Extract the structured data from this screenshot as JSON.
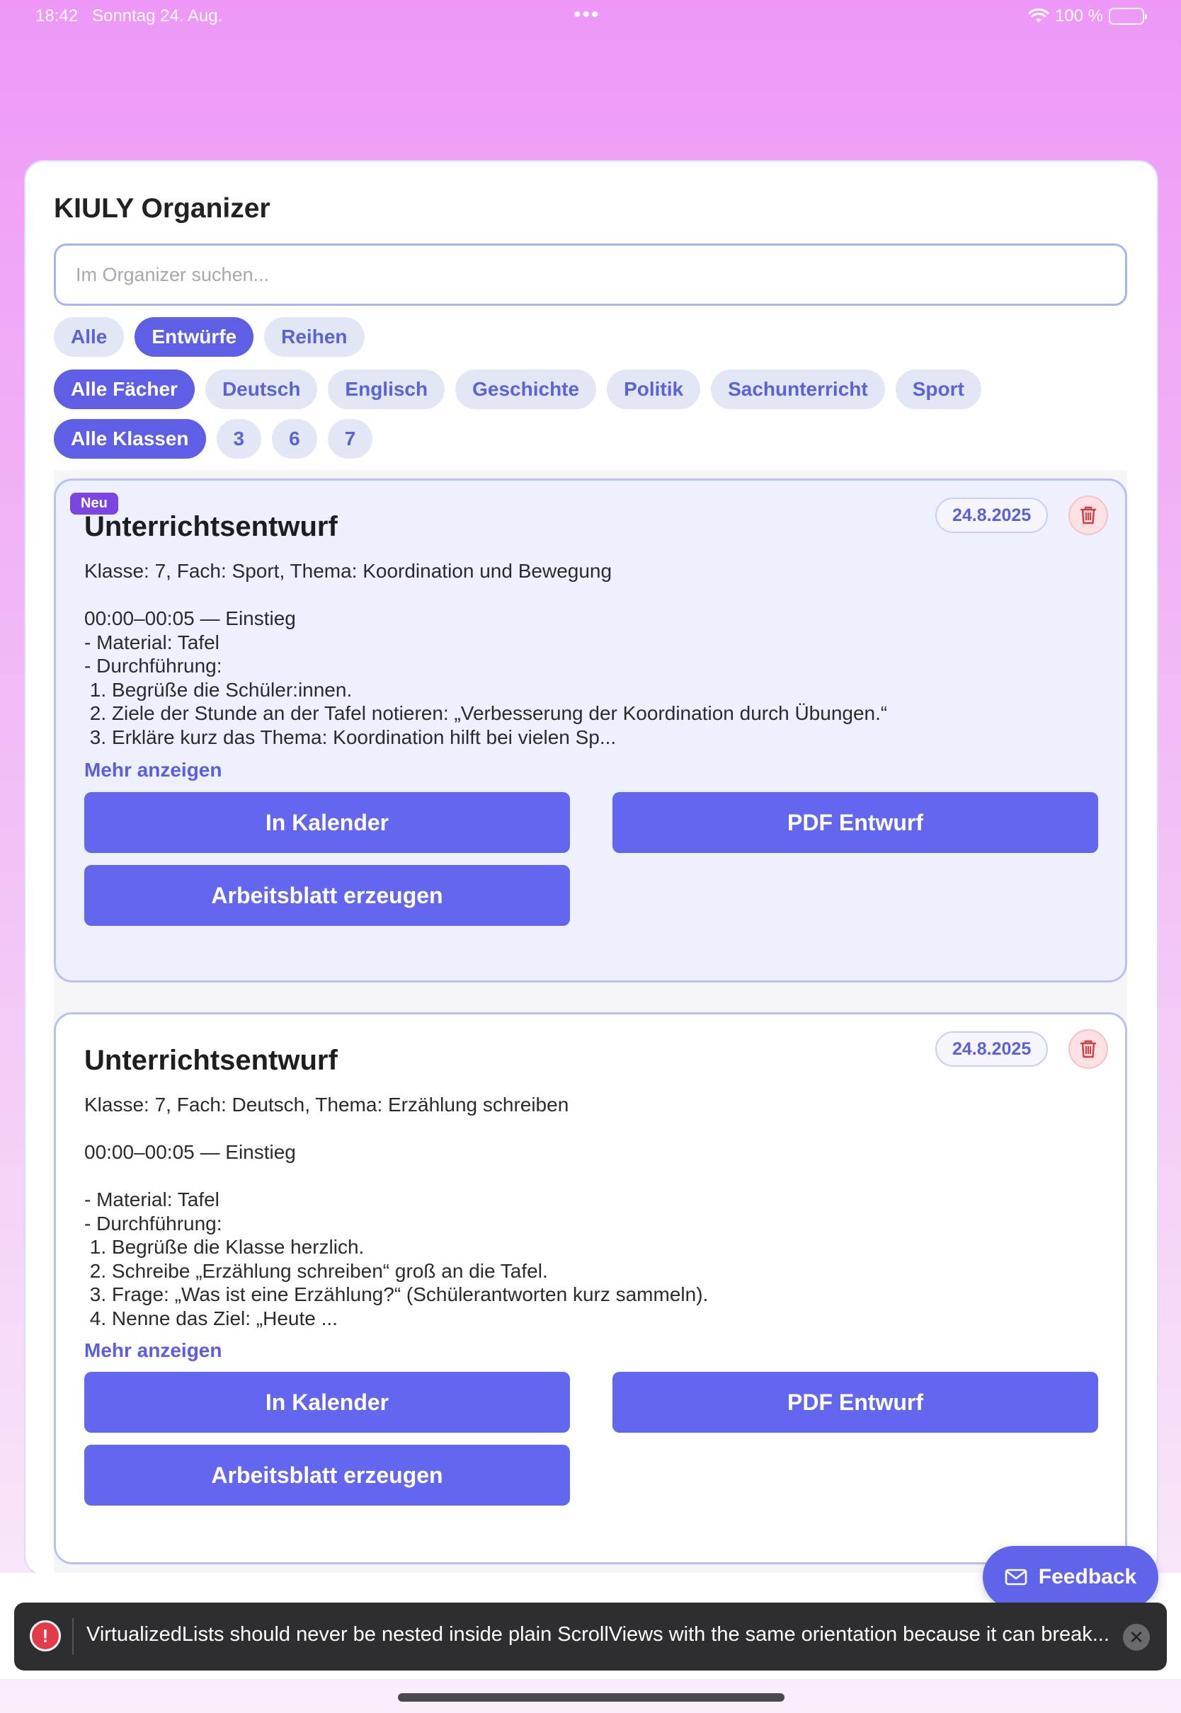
{
  "status_bar": {
    "time": "18:42",
    "date": "Sonntag 24. Aug.",
    "dots": "•••",
    "battery": "100 %"
  },
  "app": {
    "title": "KIULY Organizer",
    "search_placeholder": "Im Organizer suchen..."
  },
  "filters": {
    "types": [
      {
        "label": "Alle",
        "active": false
      },
      {
        "label": "Entwürfe",
        "active": true
      },
      {
        "label": "Reihen",
        "active": false
      }
    ],
    "subjects": [
      {
        "label": "Alle Fächer",
        "active": true
      },
      {
        "label": "Deutsch",
        "active": false
      },
      {
        "label": "Englisch",
        "active": false
      },
      {
        "label": "Geschichte",
        "active": false
      },
      {
        "label": "Politik",
        "active": false
      },
      {
        "label": "Sachunterricht",
        "active": false
      },
      {
        "label": "Sport",
        "active": false
      }
    ],
    "classes": [
      {
        "label": "Alle Klassen",
        "active": true
      },
      {
        "label": "3",
        "active": false
      },
      {
        "label": "6",
        "active": false
      },
      {
        "label": "7",
        "active": false
      }
    ]
  },
  "cards": [
    {
      "badge": "Neu",
      "title": "Unterrichtsentwurf",
      "date": "24.8.2025",
      "meta": "Klasse: 7, Fach: Sport, Thema: Koordination und Bewegung",
      "body": "00:00–00:05 — Einstieg\n- Material: Tafel\n- Durchführung:\n 1. Begrüße die Schüler:innen.\n 2. Ziele der Stunde an der Tafel notieren: „Verbesserung der Koordination durch Übungen.“\n 3. Erkläre kurz das Thema: Koordination hilft bei vielen Sp...",
      "more": "Mehr anzeigen",
      "btn_calendar": "In Kalender",
      "btn_pdf": "PDF Entwurf",
      "btn_worksheet": "Arbeitsblatt erzeugen"
    },
    {
      "title": "Unterrichtsentwurf",
      "date": "24.8.2025",
      "meta": "Klasse: 7, Fach: Deutsch, Thema: Erzählung schreiben",
      "body": "00:00–00:05 — Einstieg\n\n- Material: Tafel\n- Durchführung:\n 1. Begrüße die Klasse herzlich.\n 2. Schreibe „Erzählung schreiben“ groß an die Tafel.\n 3. Frage: „Was ist eine Erzählung?“ (Schülerantworten kurz sammeln).\n 4. Nenne das Ziel: „Heute ...",
      "more": "Mehr anzeigen",
      "btn_calendar": "In Kalender",
      "btn_pdf": "PDF Entwurf",
      "btn_worksheet": "Arbeitsblatt erzeugen"
    }
  ],
  "feedback": {
    "label": "Feedback",
    "icon": "mail-icon"
  },
  "error": {
    "icon": "!",
    "message": "VirtualizedLists should never be nested inside plain ScrollViews with the same orientation because it can break...",
    "close": "✕"
  },
  "colors": {
    "accent": "#6366ee",
    "chip_bg": "#e3e6f4",
    "badge": "#7b45e2",
    "danger": "#e43a4a"
  }
}
